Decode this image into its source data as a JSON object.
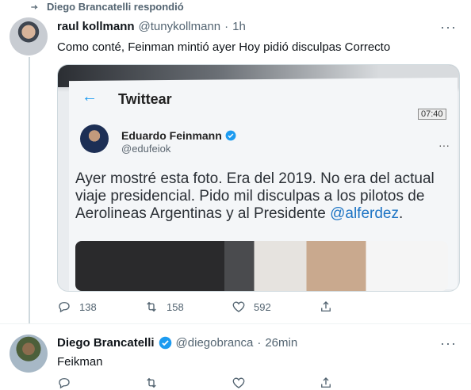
{
  "context": {
    "replied_text": "Diego Brancatelli respondió"
  },
  "tweet1": {
    "name": "raul kollmann",
    "handle": "@tunykollmann",
    "sep": "·",
    "time": "1h",
    "text": "Como conté, Feinman mintió ayer Hoy pidió disculpas Correcto",
    "more": "···",
    "media": {
      "title": "Twittear",
      "clock": "07:40",
      "author_name": "Eduardo Feinmann",
      "author_handle": "@edufeiok",
      "more": "···",
      "text": "Ayer mostré esta foto. Era del 2019. No era del actual viaje presidencial. Pido mil disculpas a los pilotos de Aerolineas Argentinas y al Presidente",
      "mention": "@alferdez",
      "mention_suffix": "."
    },
    "actions": {
      "replies": "138",
      "retweets": "158",
      "likes": "592"
    }
  },
  "tweet2": {
    "name": "Diego Brancatelli",
    "handle": "@diegobranca",
    "sep": "·",
    "time": "26min",
    "text": "Feikman",
    "more": "···"
  },
  "colors": {
    "accent": "#1d9bf0",
    "secondary_text": "#536471",
    "line": "#cfd9de"
  }
}
